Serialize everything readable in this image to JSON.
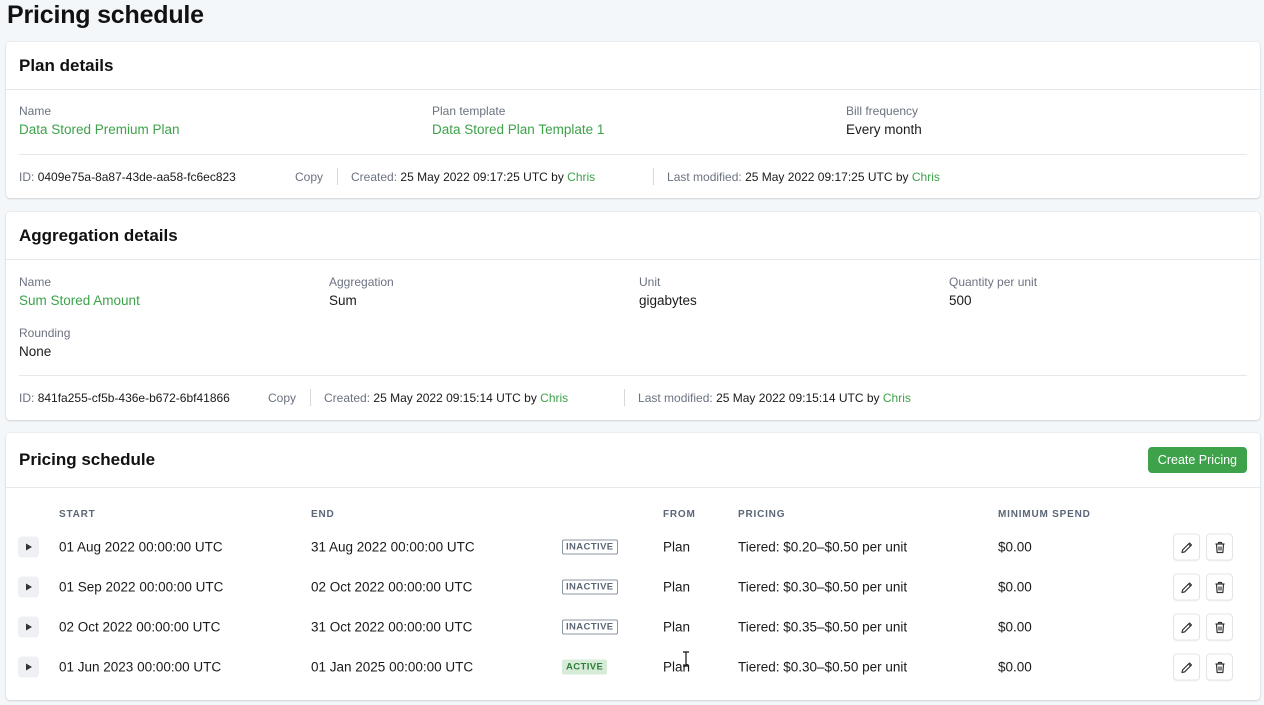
{
  "page_title": "Pricing schedule",
  "plan_details": {
    "title": "Plan details",
    "fields": [
      {
        "label": "Name",
        "value": "Data Stored Premium Plan"
      },
      {
        "label": "Plan template",
        "value": "Data Stored Plan Template 1"
      },
      {
        "label": "Bill frequency",
        "value": "Every month"
      }
    ],
    "meta": {
      "id_label": "ID:",
      "id": "0409e75a-8a87-43de-aa58-fc6ec823",
      "copy": "Copy",
      "created_label": "Created:",
      "created": "25 May 2022 09:17:25 UTC by",
      "created_by": "Chris",
      "modified_label": "Last modified:",
      "modified": "25 May 2022 09:17:25 UTC by",
      "modified_by": "Chris"
    }
  },
  "aggregation_details": {
    "title": "Aggregation details",
    "fields": [
      {
        "label": "Name",
        "value": "Sum Stored Amount"
      },
      {
        "label": "Aggregation",
        "value": "Sum"
      },
      {
        "label": "Unit",
        "value": "gigabytes"
      },
      {
        "label": "Quantity per unit",
        "value": "500"
      },
      {
        "label": "Rounding",
        "value": "None"
      }
    ],
    "meta": {
      "id_label": "ID:",
      "id": "841fa255-cf5b-436e-b672-6bf41866",
      "copy": "Copy",
      "created_label": "Created:",
      "created": "25 May 2022 09:15:14 UTC by",
      "created_by": "Chris",
      "modified_label": "Last modified:",
      "modified": "25 May 2022 09:15:14 UTC by",
      "modified_by": "Chris"
    }
  },
  "pricing_schedule": {
    "title": "Pricing schedule",
    "create_button": "Create Pricing",
    "columns": [
      "START",
      "END",
      "FROM",
      "PRICING",
      "MINIMUM SPEND"
    ],
    "rows": [
      {
        "start": "01 Aug 2022 00:00:00 UTC",
        "end": "31 Aug 2022 00:00:00 UTC",
        "status": "INACTIVE",
        "from": "Plan",
        "pricing": "Tiered: $0.20–$0.50 per unit",
        "min_spend": "$0.00"
      },
      {
        "start": "01 Sep 2022 00:00:00 UTC",
        "end": "02 Oct 2022 00:00:00 UTC",
        "status": "INACTIVE",
        "from": "Plan",
        "pricing": "Tiered: $0.30–$0.50 per unit",
        "min_spend": "$0.00"
      },
      {
        "start": "02 Oct 2022 00:00:00 UTC",
        "end": "31 Oct 2022 00:00:00 UTC",
        "status": "INACTIVE",
        "from": "Plan",
        "pricing": "Tiered: $0.35–$0.50 per unit",
        "min_spend": "$0.00"
      },
      {
        "start": "01 Jun 2023 00:00:00 UTC",
        "end": "01 Jan 2025 00:00:00 UTC",
        "status": "ACTIVE",
        "from": "Plan",
        "pricing": "Tiered: $0.30–$0.50 per unit",
        "min_spend": "$0.00"
      }
    ]
  },
  "colors": {
    "accent_green": "#3da24a",
    "active_badge_bg": "#d6ecd8"
  },
  "icons": [
    "chevron-right-icon",
    "pencil-icon",
    "trash-icon"
  ]
}
